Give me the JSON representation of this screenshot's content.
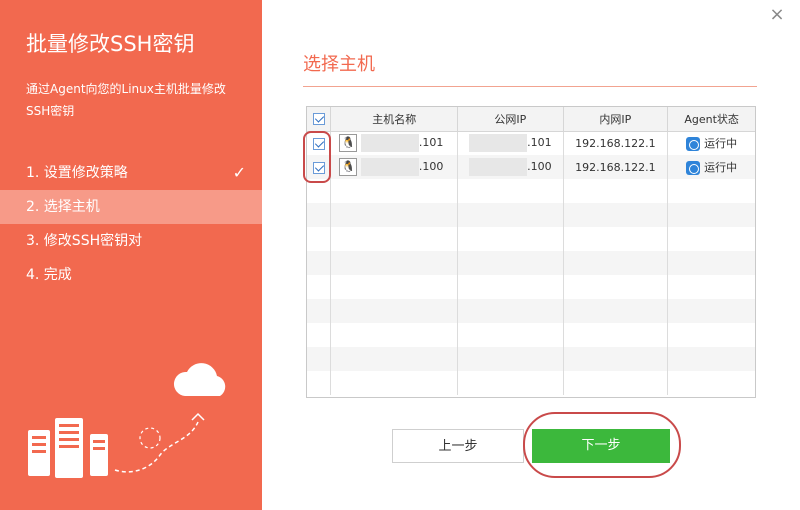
{
  "sidebar": {
    "title": "批量修改SSH密钥",
    "description": "通过Agent向您的Linux主机批量修改SSH密钥",
    "steps": [
      {
        "label": "1. 设置修改策略",
        "done": true
      },
      {
        "label": "2. 选择主机",
        "active": true
      },
      {
        "label": "3. 修改SSH密钥对"
      },
      {
        "label": "4. 完成"
      }
    ],
    "check_icon": "check-icon"
  },
  "main": {
    "title": "选择主机",
    "table": {
      "headers": [
        "主机名称",
        "公网IP",
        "内网IP",
        "Agent状态"
      ],
      "rows": [
        {
          "host_suffix": ".101",
          "public_ip_suffix": ".101",
          "private_ip": "192.168.122.1",
          "status": "运行中"
        },
        {
          "host_suffix": ".100",
          "public_ip_suffix": ".100",
          "private_ip": "192.168.122.1",
          "status": "运行中"
        }
      ]
    },
    "buttons": {
      "prev": "上一步",
      "next": "下一步"
    }
  },
  "colors": {
    "accent": "#f2694f",
    "next_button": "#3cb83c",
    "status_icon": "#2f84d9"
  }
}
